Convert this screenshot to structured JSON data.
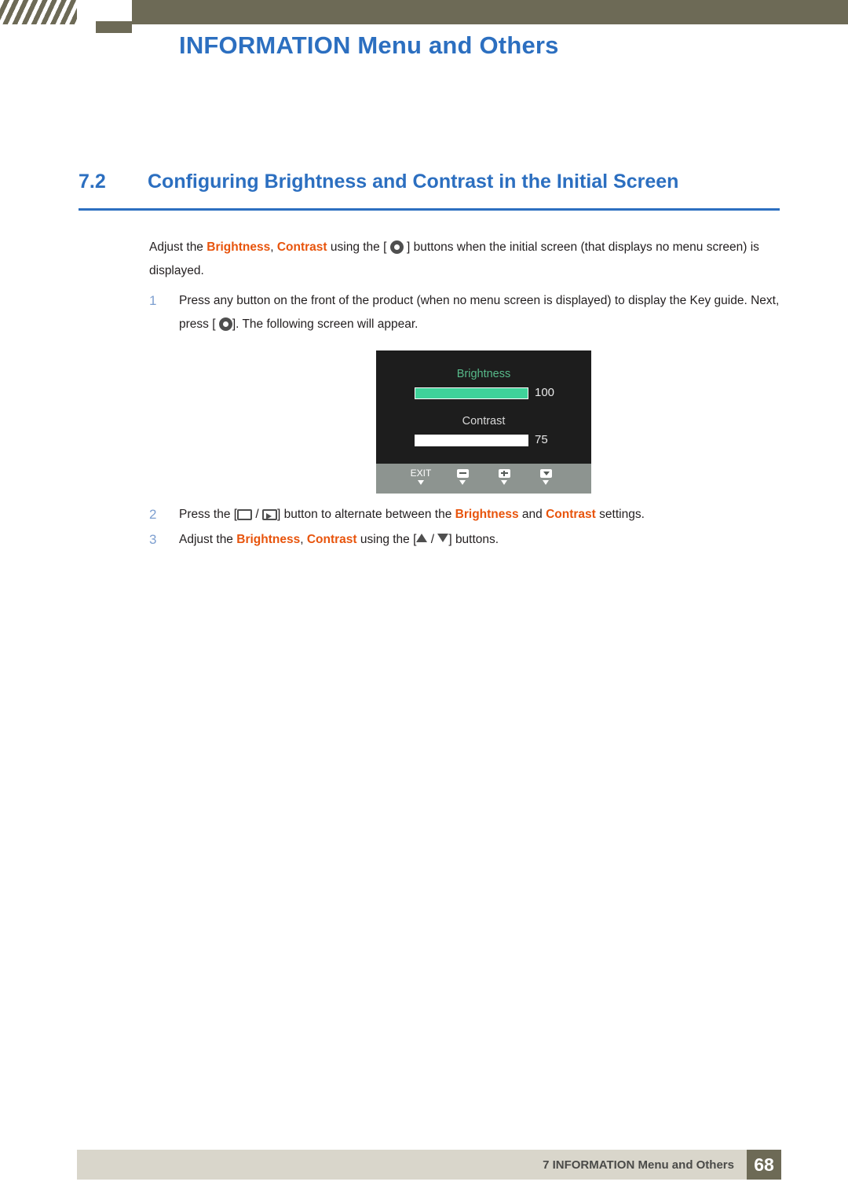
{
  "header": {
    "title": "INFORMATION Menu and Others"
  },
  "section": {
    "number": "7.2",
    "title": "Configuring Brightness and Contrast in the Initial Screen"
  },
  "intro": {
    "before": "Adjust the ",
    "kw1": "Brightness",
    "sep": ", ",
    "kw2": "Contrast",
    "middle": " using the [",
    "after": "] buttons when the initial screen (that displays no menu screen) is displayed."
  },
  "steps": [
    {
      "num": "1",
      "text_a": "Press any button on the front of the product (when no menu screen is displayed) to display the Key guide. Next, press [",
      "text_b": "]. The following screen will appear."
    },
    {
      "num": "2",
      "text_a": "Press the [",
      "text_b": "] button to alternate between the ",
      "kw1": "Brightness",
      "text_c": " and ",
      "kw2": "Contrast",
      "text_d": " settings."
    },
    {
      "num": "3",
      "text_a": "Adjust the ",
      "kw1": "Brightness",
      "sep": ", ",
      "kw2": "Contrast",
      "text_b": " using the [",
      "text_c": "] buttons."
    }
  ],
  "osd": {
    "brightness_label": "Brightness",
    "brightness_value": "100",
    "brightness_fill_pct": 100,
    "contrast_label": "Contrast",
    "contrast_value": "75",
    "contrast_fill_pct": 75,
    "keys": [
      {
        "label": "EXIT",
        "icon": "exit-text"
      },
      {
        "label": "",
        "icon": "minus-icon"
      },
      {
        "label": "",
        "icon": "plus-icon"
      },
      {
        "label": "",
        "icon": "down-arrow-icon"
      }
    ]
  },
  "footer": {
    "text": "7 INFORMATION Menu and Others",
    "page": "68"
  },
  "colors": {
    "accent_blue": "#2c6fc0",
    "keyword_orange": "#e8540c",
    "header_olive": "#6d6a56",
    "footer_beige": "#d9d6cb",
    "osd_green": "#3fd29a"
  }
}
